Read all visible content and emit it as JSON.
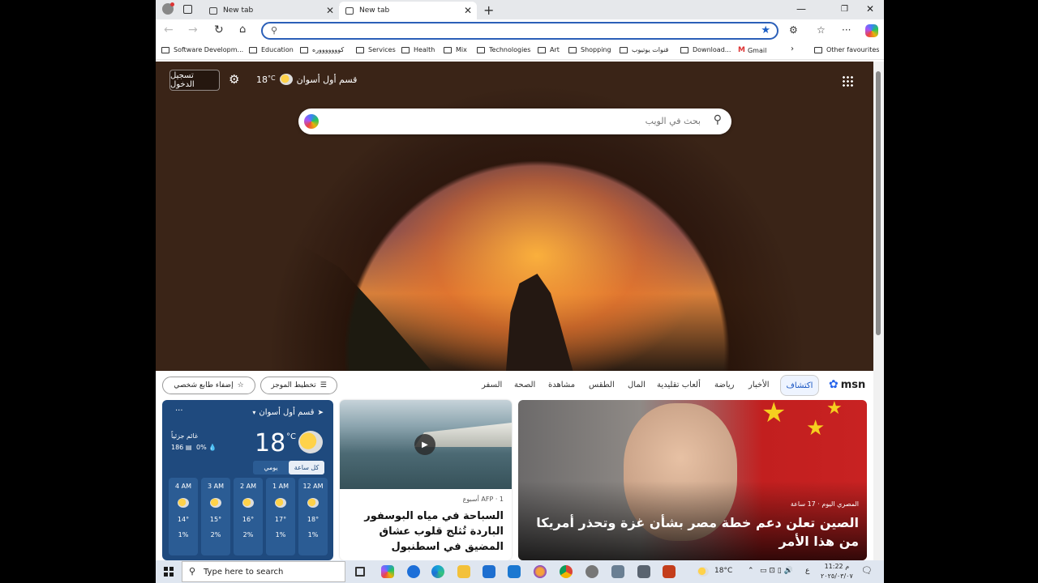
{
  "browser": {
    "tabs": [
      {
        "label": "New tab",
        "active": false
      },
      {
        "label": "New tab",
        "active": true
      }
    ],
    "new_tab_symbol": "+",
    "address_value": "",
    "favorites": [
      "Software Developm...",
      "Education",
      "كوووووووره",
      "Services",
      "Health",
      "Mix",
      "Technologies",
      "Art",
      "Shopping",
      "قنوات يوتيوب",
      "Download...",
      "Gmail",
      "Other favourites"
    ]
  },
  "page": {
    "signin_label": "تسجيل الدخول",
    "weather_top": {
      "temp": "18",
      "unit": "°C",
      "location": "قسم أول أسوان"
    },
    "search_placeholder": "بحث في الويب"
  },
  "nav": {
    "items": [
      "الأخبار",
      "رياضة",
      "ألعاب تقليدية",
      "المال",
      "الطقس",
      "مشاهدة",
      "الصحة",
      "السفر"
    ],
    "active": "اكتشاف",
    "brand": "msn",
    "feed_layout_label": "تخطيط الموجز",
    "personalize_label": "إضفاء طابع شخصي"
  },
  "weather_card": {
    "location": "قسم أول أسوان",
    "temp": "18",
    "unit": "°C",
    "label": "غائم جزئياً",
    "stat_a": "186",
    "stat_b": "0%",
    "toggle_hourly": "كل ساعة",
    "toggle_daily": "يومي",
    "hours": [
      {
        "time": "4 AM",
        "temp": "14°",
        "rain": "1%"
      },
      {
        "time": "3 AM",
        "temp": "15°",
        "rain": "2%"
      },
      {
        "time": "2 AM",
        "temp": "16°",
        "rain": "2%"
      },
      {
        "time": "1 AM",
        "temp": "17°",
        "rain": "1%"
      },
      {
        "time": "12 AM",
        "temp": "18°",
        "rain": "1%"
      }
    ]
  },
  "mid_card": {
    "meta": "AFP · 1 أسبوع",
    "title": "السباحة في مياه البوسفور الباردة تُثلج قلوب عشاق المضيق في اسطنبول"
  },
  "big_card": {
    "meta": "المصري اليوم · 17 ساعة",
    "title": "الصين تعلن دعم خطة مصر بشأن غزة وتحذر أمريكا من هذا الأمر"
  },
  "taskbar": {
    "search_placeholder": "Type here to search",
    "weather": "18°C",
    "lang": "ع",
    "time": "11:22 م",
    "date": "٢٠٢٥/٠٣/٠٧"
  }
}
